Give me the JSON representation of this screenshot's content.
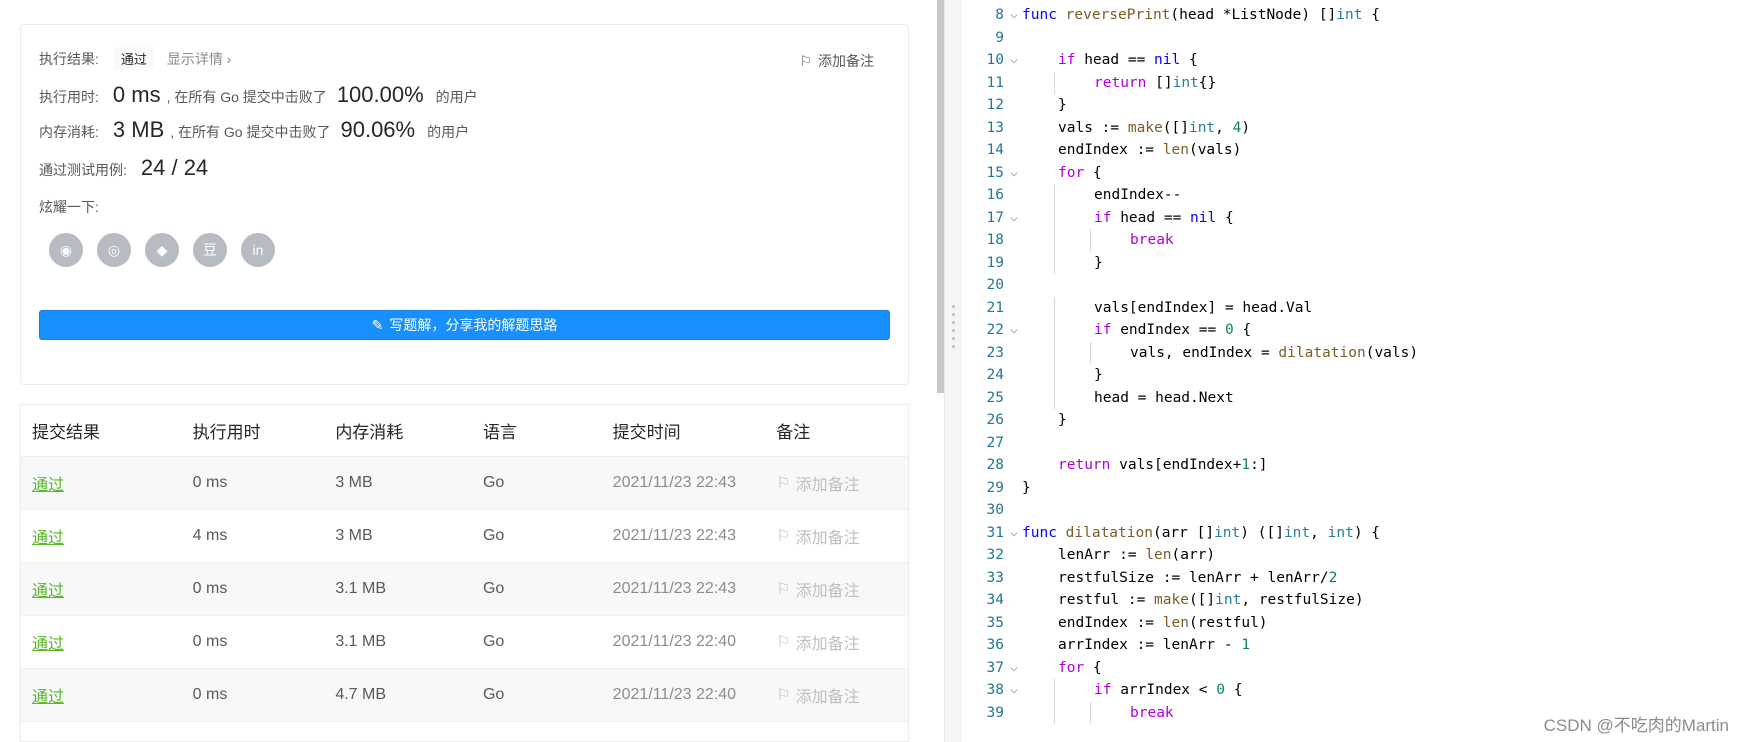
{
  "result": {
    "status_label": "执行结果:",
    "status_value": "通过",
    "details_link": "显示详情 ›",
    "add_note": "添加备注",
    "runtime_label": "执行用时:",
    "runtime_value": "0 ms",
    "runtime_desc": ", 在所有 Go 提交中击败了",
    "runtime_pct": "100.00%",
    "runtime_suffix": "的用户",
    "memory_label": "内存消耗:",
    "memory_value": "3 MB",
    "memory_desc": ", 在所有 Go 提交中击败了",
    "memory_pct": "90.06%",
    "memory_suffix": "的用户",
    "tests_label": "通过测试用例:",
    "tests_value": "24 / 24",
    "share_label": "炫耀一下:",
    "share_icons": [
      "wechat-icon",
      "weibo-icon",
      "qq-icon",
      "douban-icon",
      "linkedin-icon"
    ],
    "share_glyphs": [
      "◉",
      "◎",
      "◆",
      "豆",
      "in"
    ],
    "write_button": "写题解，分享我的解题思路"
  },
  "table": {
    "headers": [
      "提交结果",
      "执行用时",
      "内存消耗",
      "语言",
      "提交时间",
      "备注"
    ],
    "rows": [
      {
        "result": "通过",
        "time": "0 ms",
        "mem": "3 MB",
        "lang": "Go",
        "ts": "2021/11/23 22:43",
        "note": "添加备注"
      },
      {
        "result": "通过",
        "time": "4 ms",
        "mem": "3 MB",
        "lang": "Go",
        "ts": "2021/11/23 22:43",
        "note": "添加备注"
      },
      {
        "result": "通过",
        "time": "0 ms",
        "mem": "3.1 MB",
        "lang": "Go",
        "ts": "2021/11/23 22:43",
        "note": "添加备注"
      },
      {
        "result": "通过",
        "time": "0 ms",
        "mem": "3.1 MB",
        "lang": "Go",
        "ts": "2021/11/23 22:40",
        "note": "添加备注"
      },
      {
        "result": "通过",
        "time": "0 ms",
        "mem": "4.7 MB",
        "lang": "Go",
        "ts": "2021/11/23 22:40",
        "note": "添加备注"
      }
    ]
  },
  "code": {
    "lines": [
      {
        "n": "8",
        "fold": true,
        "indent": 0,
        "html": "<span class='kb'>func</span> <span class='fn'>reversePrint</span>(head *ListNode) []<span class='ty'>int</span> {"
      },
      {
        "n": "9",
        "fold": false,
        "indent": 0,
        "html": ""
      },
      {
        "n": "10",
        "fold": true,
        "indent": 1,
        "html": "<span class='kw'>if</span> head == <span class='kb'>nil</span> {"
      },
      {
        "n": "11",
        "fold": false,
        "indent": 2,
        "html": "<span class='kw'>return</span> []<span class='ty'>int</span>{}"
      },
      {
        "n": "12",
        "fold": false,
        "indent": 1,
        "html": "}"
      },
      {
        "n": "13",
        "fold": false,
        "indent": 1,
        "html": "vals := <span class='fn'>make</span>([]<span class='ty'>int</span>, <span class='nu'>4</span>)"
      },
      {
        "n": "14",
        "fold": false,
        "indent": 1,
        "html": "endIndex := <span class='fn'>len</span>(vals)"
      },
      {
        "n": "15",
        "fold": true,
        "indent": 1,
        "html": "<span class='kw'>for</span> {"
      },
      {
        "n": "16",
        "fold": false,
        "indent": 2,
        "html": "endIndex--"
      },
      {
        "n": "17",
        "fold": true,
        "indent": 2,
        "html": "<span class='kw'>if</span> head == <span class='kb'>nil</span> {"
      },
      {
        "n": "18",
        "fold": false,
        "indent": 3,
        "html": "<span class='kw'>break</span>"
      },
      {
        "n": "19",
        "fold": false,
        "indent": 2,
        "html": "}"
      },
      {
        "n": "20",
        "fold": false,
        "indent": 0,
        "html": ""
      },
      {
        "n": "21",
        "fold": false,
        "indent": 2,
        "html": "vals[endIndex] = head.Val"
      },
      {
        "n": "22",
        "fold": true,
        "indent": 2,
        "html": "<span class='kw'>if</span> endIndex == <span class='nu'>0</span> {"
      },
      {
        "n": "23",
        "fold": false,
        "indent": 3,
        "html": "vals, endIndex = <span class='fn'>dilatation</span>(vals)"
      },
      {
        "n": "24",
        "fold": false,
        "indent": 2,
        "html": "}"
      },
      {
        "n": "25",
        "fold": false,
        "indent": 2,
        "html": "head = head.Next"
      },
      {
        "n": "26",
        "fold": false,
        "indent": 1,
        "html": "}"
      },
      {
        "n": "27",
        "fold": false,
        "indent": 0,
        "html": ""
      },
      {
        "n": "28",
        "fold": false,
        "indent": 1,
        "html": "<span class='kw'>return</span> vals[endIndex+<span class='nu'>1</span>:]"
      },
      {
        "n": "29",
        "fold": false,
        "indent": 0,
        "html": "}"
      },
      {
        "n": "30",
        "fold": false,
        "indent": 0,
        "html": ""
      },
      {
        "n": "31",
        "fold": true,
        "indent": 0,
        "html": "<span class='kb'>func</span> <span class='fn'>dilatation</span>(arr []<span class='ty'>int</span>) ([]<span class='ty'>int</span>, <span class='ty'>int</span>) {"
      },
      {
        "n": "32",
        "fold": false,
        "indent": 1,
        "html": "lenArr := <span class='fn'>len</span>(arr)"
      },
      {
        "n": "33",
        "fold": false,
        "indent": 1,
        "html": "restfulSize := lenArr + lenArr/<span class='nu'>2</span>"
      },
      {
        "n": "34",
        "fold": false,
        "indent": 1,
        "html": "restful := <span class='fn'>make</span>([]<span class='ty'>int</span>, restfulSize)"
      },
      {
        "n": "35",
        "fold": false,
        "indent": 1,
        "html": "endIndex := <span class='fn'>len</span>(restful)"
      },
      {
        "n": "36",
        "fold": false,
        "indent": 1,
        "html": "arrIndex := lenArr - <span class='nu'>1</span>"
      },
      {
        "n": "37",
        "fold": true,
        "indent": 1,
        "html": "<span class='kw'>for</span> {"
      },
      {
        "n": "38",
        "fold": true,
        "indent": 2,
        "html": "<span class='kw'>if</span> arrIndex &lt; <span class='nu'>0</span> {"
      },
      {
        "n": "39",
        "fold": false,
        "indent": 3,
        "html": "<span class='kw'>break</span>"
      }
    ]
  },
  "watermark": "CSDN @不吃肉的Martin"
}
